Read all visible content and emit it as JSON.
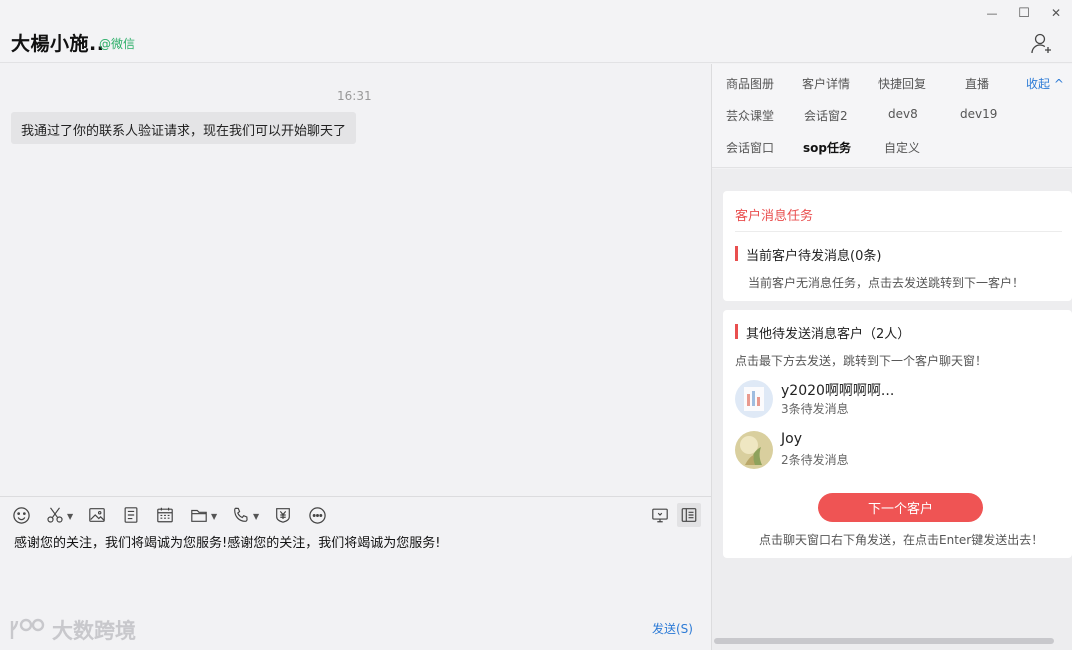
{
  "header": {
    "chat_name": "大楊小施..",
    "chat_source": "@微信",
    "minimize": "—",
    "maximize": "☐",
    "close": "✕"
  },
  "chat": {
    "time": "16:31",
    "system_message": "我通过了你的联系人验证请求，现在我们可以开始聊天了"
  },
  "toolbar": {
    "icons": [
      "emoji-icon",
      "scissors-icon",
      "image-icon",
      "document-icon",
      "calendar-icon",
      "folder-icon",
      "phone-icon",
      "payment-icon",
      "more-icon",
      "screen-icon",
      "sidebar-icon"
    ]
  },
  "compose": {
    "text": "感谢您的关注，我们将竭诚为您服务!感谢您的关注，我们将竭诚为您服务!",
    "send_label": "发送(S)"
  },
  "watermark": {
    "text": "大数跨境"
  },
  "side_tabs": {
    "row1": [
      "商品图册",
      "客户详情",
      "快捷回复",
      "直播"
    ],
    "collapse": "收起 ^",
    "row2": [
      "芸众课堂",
      "会话窗2",
      "dev8",
      "dev19"
    ],
    "row3": [
      "会话窗口",
      "sop任务",
      "自定义"
    ],
    "active": "sop任务"
  },
  "task_card": {
    "title": "客户消息任务",
    "current_title": "当前客户待发消息(0条)",
    "current_desc": "当前客户无消息任务，点击去发送跳转到下一客户！"
  },
  "others_card": {
    "title": "其他待发送消息客户（2人）",
    "desc": "点击最下方去发送，跳转到下一个客户聊天窗！",
    "customers": [
      {
        "name": "y2020啊啊啊啊...",
        "count": "3条待发消息"
      },
      {
        "name": "Joy",
        "count": "2条待发消息"
      }
    ],
    "next_button": "下一个客户",
    "hint": "点击聊天窗口右下角发送，在点击Enter键发送出去！"
  },
  "colors": {
    "accent_red": "#ef5454",
    "link_blue": "#2d7bd6",
    "wechat_green": "#2aae67"
  }
}
